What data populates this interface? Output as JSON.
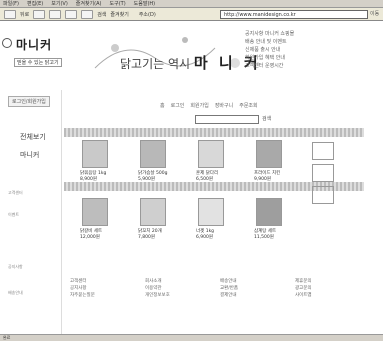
{
  "browser": {
    "menu": [
      "파일(F)",
      "편집(E)",
      "보기(V)",
      "즐겨찾기(A)",
      "도구(T)",
      "도움말(H)"
    ],
    "toolbar": [
      "뒤로",
      "앞으로",
      "중지",
      "새로 고침",
      "홈",
      "검색",
      "즐겨찾기"
    ],
    "address_label": "주소(D)",
    "address": "http://www.manidesign.co.kr",
    "go": "이동"
  },
  "site": {
    "logo": "마니커",
    "logo_sub": "믿을 수 있는 닭고기",
    "banner_prefix": "닭고기는 역시",
    "banner_brand": "마 니 커",
    "notice_lines": [
      "공지사항 마니커 쇼핑몰",
      "배송 안내 및 이벤트",
      "신제품 출시 안내",
      "회원가입 혜택 안내",
      "고객센터 운영시간"
    ],
    "login_badge": "로그인/회원가입",
    "left_menu": [
      "전체보기",
      "마니커"
    ],
    "left_small": [
      "고객센터",
      "이벤트",
      "공지사항",
      "배송안내"
    ],
    "topnav": [
      "홈",
      "로그인",
      "회원가입",
      "장바구니",
      "주문조회"
    ],
    "search_btn": "검색"
  },
  "products_row1": [
    {
      "name": "닭볶음탕 1kg",
      "price": "8,900원"
    },
    {
      "name": "닭가슴살 500g",
      "price": "5,900원"
    },
    {
      "name": "훈제 닭다리",
      "price": "6,500원"
    },
    {
      "name": "프라이드 치킨",
      "price": "9,900원"
    }
  ],
  "products_row2": [
    {
      "name": "닭갈비 세트",
      "price": "12,000원"
    },
    {
      "name": "닭꼬치 20개",
      "price": "7,800원"
    },
    {
      "name": "너겟 1kg",
      "price": "6,900원"
    },
    {
      "name": "삼계탕 세트",
      "price": "11,500원"
    }
  ],
  "footer_cols": [
    [
      "고객센터",
      "공지사항",
      "자주묻는질문"
    ],
    [
      "회사소개",
      "이용약관",
      "개인정보보호"
    ],
    [
      "배송안내",
      "교환/반품",
      "결제안내"
    ],
    [
      "제휴문의",
      "광고문의",
      "사이트맵"
    ]
  ],
  "status": "완료"
}
